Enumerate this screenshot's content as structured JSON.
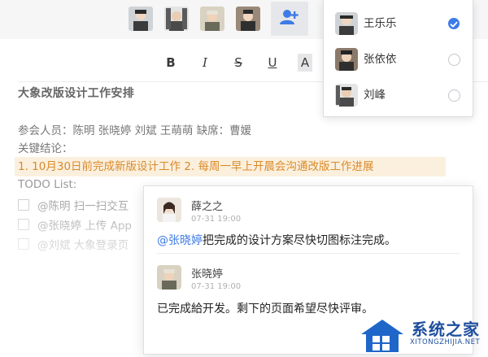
{
  "toolbar": {
    "bold": "B",
    "italic": "I",
    "strike": "S",
    "underline": "U",
    "font_color": "A"
  },
  "document": {
    "title": "大象改版设计工作安排",
    "attendees_line": "参会人员：陈明 张晓婷 刘斌 王萌萌      缺席：曹媛",
    "conclusion_label": "关键结论：",
    "conclusion_text": "1. 10月30日前完成新版设计工作    2. 每周一早上开晨会沟通改版工作进展",
    "todo_label": "TODO List:",
    "todos": [
      "@陈明 扫一扫交互",
      "@张晓婷 上传 App",
      "@刘斌 大象登录页"
    ]
  },
  "dropdown": {
    "items": [
      {
        "name": "王乐乐",
        "checked": true
      },
      {
        "name": "张依依",
        "checked": false
      },
      {
        "name": "刘峰",
        "checked": false
      }
    ]
  },
  "comments": [
    {
      "author": "薛之之",
      "time": "07-31 19:00",
      "mention": "@张晓婷",
      "text": "把完成的设计方案尽快切图标注完成。"
    },
    {
      "author": "张晓婷",
      "time": "07-31 19:00",
      "text": "已完成給开发。剩下的页面希望尽快评审。"
    }
  ],
  "watermark": {
    "brand": "系统之家",
    "url": "XITONGZHIJIA.NET"
  },
  "colors": {
    "accent": "#3d7be6",
    "highlight_bg": "#fbf0de",
    "highlight_text": "#d98a2a"
  }
}
